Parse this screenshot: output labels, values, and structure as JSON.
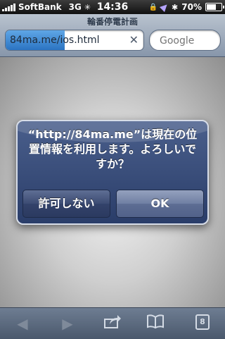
{
  "status_bar": {
    "carrier": "SoftBank",
    "network": "3G",
    "time": "14:36",
    "battery": "70%",
    "battery_level": 0.7
  },
  "browser": {
    "page_title": "輪番停電計画",
    "url": "84ma.me/ios.html",
    "load_progress": 0.43,
    "search_placeholder": "Google"
  },
  "alert": {
    "message": "“http://84ma.me”は現在の位置情報を利用します。よろしいですか？",
    "cancel_label": "許可しない",
    "ok_label": "OK"
  },
  "toolbar": {
    "tab_count": "8"
  },
  "colors": {
    "alert_bg": "#2a3d69",
    "toolbar_bg": "#4a586c"
  }
}
